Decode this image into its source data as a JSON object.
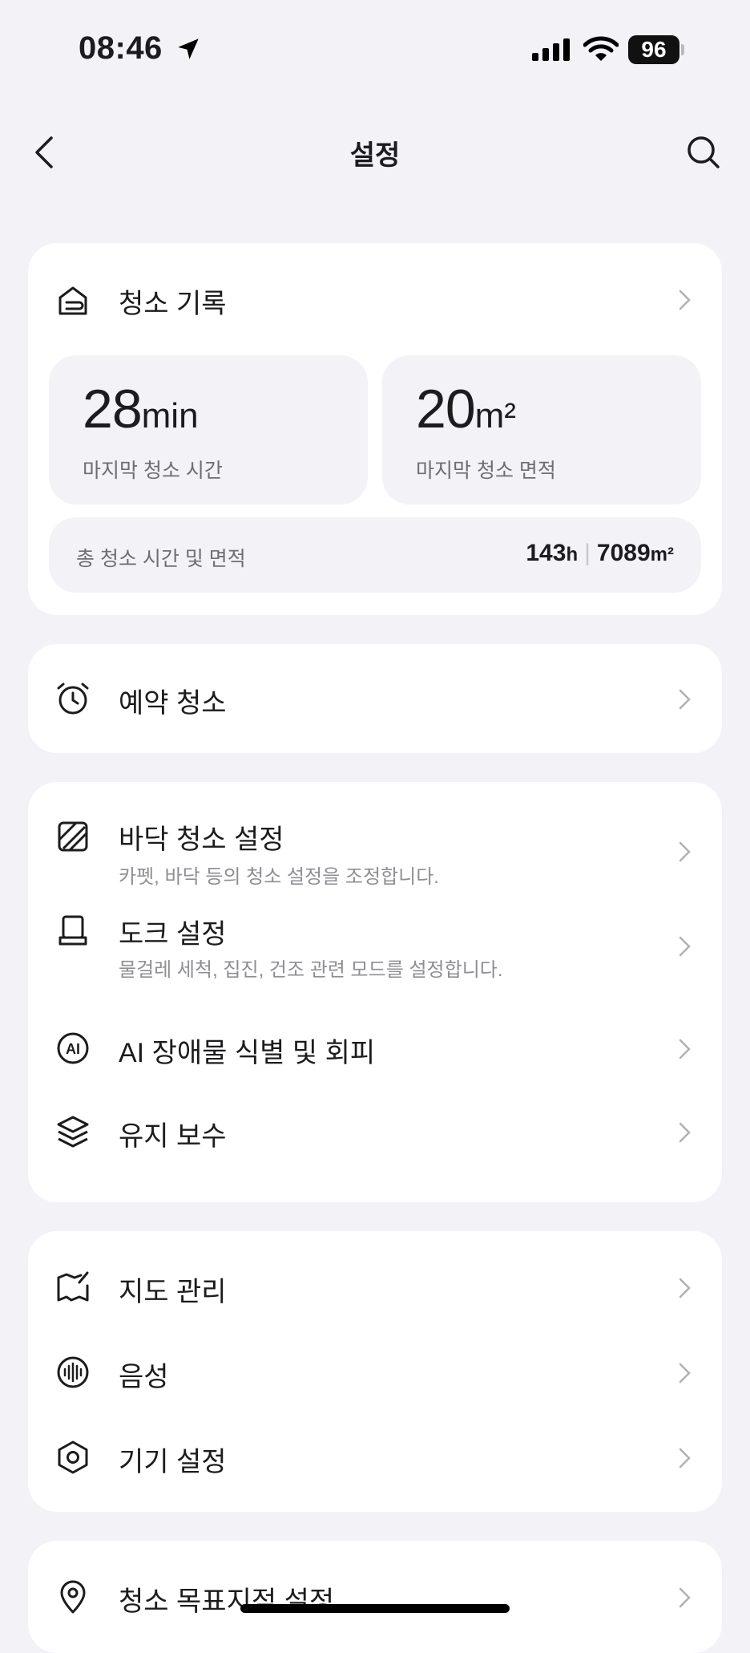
{
  "status_bar": {
    "time": "08:46",
    "battery": "96"
  },
  "header": {
    "title": "설정"
  },
  "history_card": {
    "label": "청소 기록",
    "last_time": {
      "value": "28",
      "unit": "min",
      "label": "마지막 청소 시간"
    },
    "last_area": {
      "value": "20",
      "unit": "m²",
      "label": "마지막 청소 면적"
    },
    "total": {
      "label": "총 청소 시간 및 면적",
      "hours": "143",
      "hours_unit": "h",
      "separator": "|",
      "area": "7089",
      "area_unit": "m²"
    }
  },
  "schedule_card": {
    "label": "예약 청소"
  },
  "settings_card": {
    "floor": {
      "label": "바닥 청소 설정",
      "sub": "카펫, 바닥 등의 청소 설정을 조정합니다."
    },
    "dock": {
      "label": "도크 설정",
      "sub": "물걸레 세척, 집진, 건조 관련 모드를 설정합니다."
    },
    "ai": {
      "label": "AI 장애물 식별 및 회피"
    },
    "maintenance": {
      "label": "유지 보수"
    }
  },
  "device_card": {
    "map": {
      "label": "지도 관리"
    },
    "voice": {
      "label": "음성"
    },
    "device": {
      "label": "기기 설정"
    }
  },
  "target_card": {
    "label": "청소 목표지점 설정"
  },
  "icons": [
    "location-arrow-icon",
    "cellular-signal-icon",
    "wifi-icon",
    "back-chevron-icon",
    "search-icon",
    "cleaning-history-icon",
    "alarm-clock-icon",
    "floor-tile-icon",
    "dock-icon",
    "ai-icon",
    "layers-icon",
    "map-icon",
    "voice-waveform-icon",
    "hexagon-gear-icon",
    "map-pin-icon",
    "chevron-right-icon"
  ]
}
